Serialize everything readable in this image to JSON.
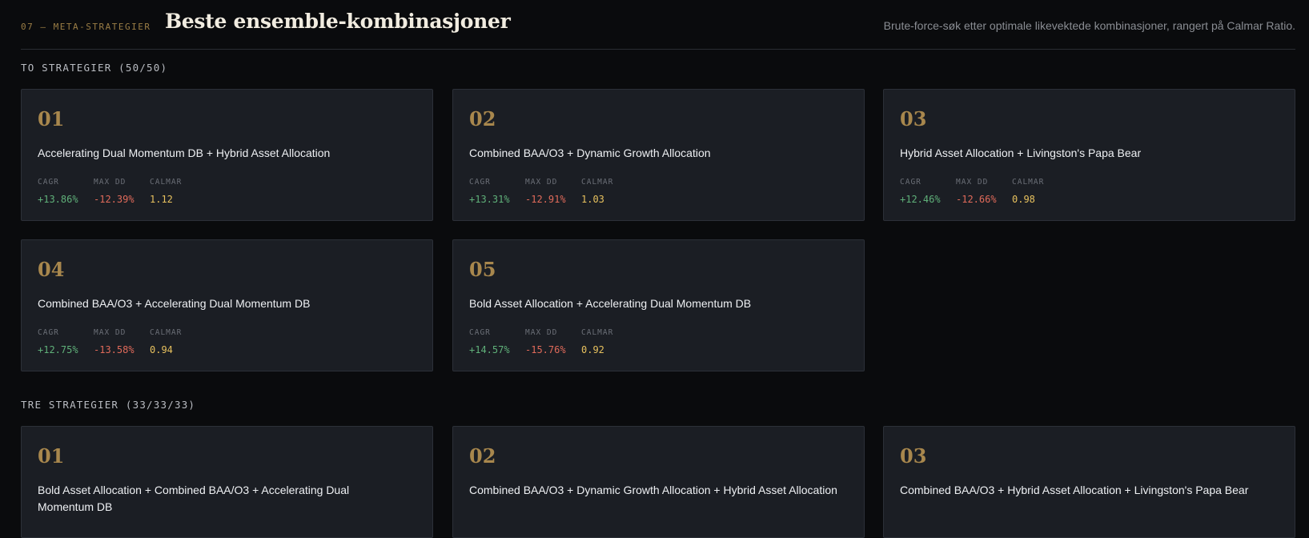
{
  "header": {
    "eyebrow": "07 — META-STRATEGIER",
    "title": "Beste ensemble-kombinasjoner",
    "subtitle": "Brute-force-søk etter optimale likevektede kombinasjoner, rangert på Calmar Ratio."
  },
  "metric_labels": {
    "cagr": "CAGR",
    "maxdd": "MAX DD",
    "calmar": "CALMAR"
  },
  "sections": [
    {
      "label": "TO STRATEGIER (50/50)",
      "cards": [
        {
          "rank": "01",
          "name": "Accelerating Dual Momentum DB + Hybrid Asset Allocation",
          "cagr": "+13.86%",
          "maxdd": "-12.39%",
          "calmar": "1.12"
        },
        {
          "rank": "02",
          "name": "Combined BAA/O3 + Dynamic Growth Allocation",
          "cagr": "+13.31%",
          "maxdd": "-12.91%",
          "calmar": "1.03"
        },
        {
          "rank": "03",
          "name": "Hybrid Asset Allocation + Livingston's Papa Bear",
          "cagr": "+12.46%",
          "maxdd": "-12.66%",
          "calmar": "0.98"
        },
        {
          "rank": "04",
          "name": "Combined BAA/O3 + Accelerating Dual Momentum DB",
          "cagr": "+12.75%",
          "maxdd": "-13.58%",
          "calmar": "0.94"
        },
        {
          "rank": "05",
          "name": "Bold Asset Allocation + Accelerating Dual Momentum DB",
          "cagr": "+14.57%",
          "maxdd": "-15.76%",
          "calmar": "0.92"
        }
      ]
    },
    {
      "label": "TRE STRATEGIER (33/33/33)",
      "cards": [
        {
          "rank": "01",
          "name": "Bold Asset Allocation + Combined BAA/O3 + Accelerating Dual Momentum DB"
        },
        {
          "rank": "02",
          "name": "Combined BAA/O3 + Dynamic Growth Allocation + Hybrid Asset Allocation"
        },
        {
          "rank": "03",
          "name": "Combined BAA/O3 + Hybrid Asset Allocation + Livingston's Papa Bear"
        }
      ]
    }
  ]
}
